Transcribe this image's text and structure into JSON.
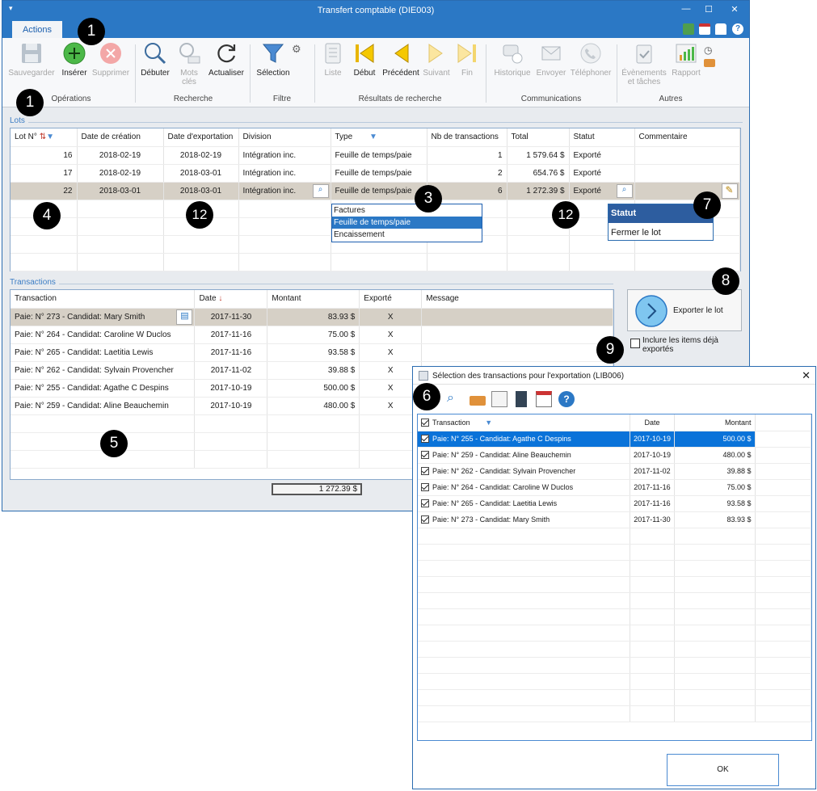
{
  "window": {
    "title": "Transfert comptable (DIE003)"
  },
  "ribbon": {
    "tab_label": "Actions",
    "groups": {
      "operations": "Opérations",
      "recherche": "Recherche",
      "filtre": "Filtre",
      "resultats": "Résultats de recherche",
      "communications": "Communications",
      "autres": "Autres"
    },
    "buttons": {
      "sauvegarder": "Sauvegarder",
      "inserer": "Insérer",
      "supprimer": "Supprimer",
      "debuter": "Débuter",
      "mots_cles_1": "Mots",
      "mots_cles_2": "clés",
      "actualiser": "Actualiser",
      "selection": "Sélection",
      "liste": "Liste",
      "debut": "Début",
      "precedent": "Précédent",
      "suivant": "Suivant",
      "fin": "Fin",
      "historique": "Historique",
      "envoyer": "Envoyer",
      "telephoner": "Téléphoner",
      "evenements_1": "Évènements",
      "evenements_2": "et tâches",
      "rapport": "Rapport"
    }
  },
  "lots": {
    "section_label": "Lots",
    "headers": [
      "Lot N°",
      "Date de création",
      "Date d'exportation",
      "Division",
      "Type",
      "Nb de transactions",
      "Total",
      "Statut",
      "Commentaire"
    ],
    "rows": [
      {
        "lot": "16",
        "creation": "2018-02-19",
        "export": "2018-02-19",
        "division": "Intégration inc.",
        "type": "Feuille de temps/paie",
        "nb": "1",
        "total": "1 579.64 $",
        "statut": "Exporté"
      },
      {
        "lot": "17",
        "creation": "2018-02-19",
        "export": "2018-03-01",
        "division": "Intégration inc.",
        "type": "Feuille de temps/paie",
        "nb": "2",
        "total": "654.76 $",
        "statut": "Exporté"
      },
      {
        "lot": "22",
        "creation": "2018-03-01",
        "export": "2018-03-01",
        "division": "Intégration inc.",
        "type": "Feuille de temps/paie",
        "nb": "6",
        "total": "1 272.39 $",
        "statut": "Exporté"
      }
    ],
    "type_dropdown": [
      "Factures",
      "Feuille de temps/paie",
      "Encaissement"
    ],
    "status_menu": {
      "header": "Statut",
      "item": "Fermer le lot"
    }
  },
  "transactions": {
    "section_label": "Transactions",
    "headers": [
      "Transaction",
      "Date",
      "Montant",
      "Exporté",
      "Message"
    ],
    "rows": [
      {
        "name": "Paie: N° 273 - Candidat: Mary Smith",
        "date": "2017-11-30",
        "montant": "83.93 $",
        "exporte": "X"
      },
      {
        "name": "Paie: N° 264 - Candidat: Caroline W Duclos",
        "date": "2017-11-16",
        "montant": "75.00 $",
        "exporte": "X"
      },
      {
        "name": "Paie: N° 265 - Candidat: Laetitia Lewis",
        "date": "2017-11-16",
        "montant": "93.58 $",
        "exporte": "X"
      },
      {
        "name": "Paie: N° 262 - Candidat: Sylvain Provencher",
        "date": "2017-11-02",
        "montant": "39.88 $",
        "exporte": "X"
      },
      {
        "name": "Paie: N° 255 - Candidat: Agathe C Despins",
        "date": "2017-10-19",
        "montant": "500.00 $",
        "exporte": "X"
      },
      {
        "name": "Paie: N° 259 - Candidat: Aline Beauchemin",
        "date": "2017-10-19",
        "montant": "480.00 $",
        "exporte": "X"
      }
    ],
    "total": "1 272.39 $"
  },
  "export": {
    "button_label": "Exporter le lot",
    "include_label_1": "Inclure les items déjà",
    "include_label_2": "exportés"
  },
  "dialog": {
    "title": "Sélection des transactions pour l'exportation (LIB006)",
    "headers": [
      "Transaction",
      "Date",
      "Montant"
    ],
    "rows": [
      {
        "name": "Paie: N° 255 - Candidat: Agathe C Despins",
        "date": "2017-10-19",
        "montant": "500.00 $"
      },
      {
        "name": "Paie: N° 259 - Candidat: Aline Beauchemin",
        "date": "2017-10-19",
        "montant": "480.00 $"
      },
      {
        "name": "Paie: N° 262 - Candidat: Sylvain Provencher",
        "date": "2017-11-02",
        "montant": "39.88 $"
      },
      {
        "name": "Paie: N° 264 - Candidat: Caroline W Duclos",
        "date": "2017-11-16",
        "montant": "75.00 $"
      },
      {
        "name": "Paie: N° 265 - Candidat: Laetitia Lewis",
        "date": "2017-11-16",
        "montant": "93.58 $"
      },
      {
        "name": "Paie: N° 273 - Candidat: Mary Smith",
        "date": "2017-11-30",
        "montant": "83.93 $"
      }
    ],
    "ok_label": "OK"
  },
  "callouts": {
    "c1": "1",
    "c3": "3",
    "c4": "4",
    "c5": "5",
    "c6": "6",
    "c7": "7",
    "c8": "8",
    "c9": "9",
    "c12": "12"
  },
  "colors": {
    "titlebar": "#2b78c5",
    "selection": "#0a73d9",
    "row_highlight": "#d6d0c6"
  }
}
